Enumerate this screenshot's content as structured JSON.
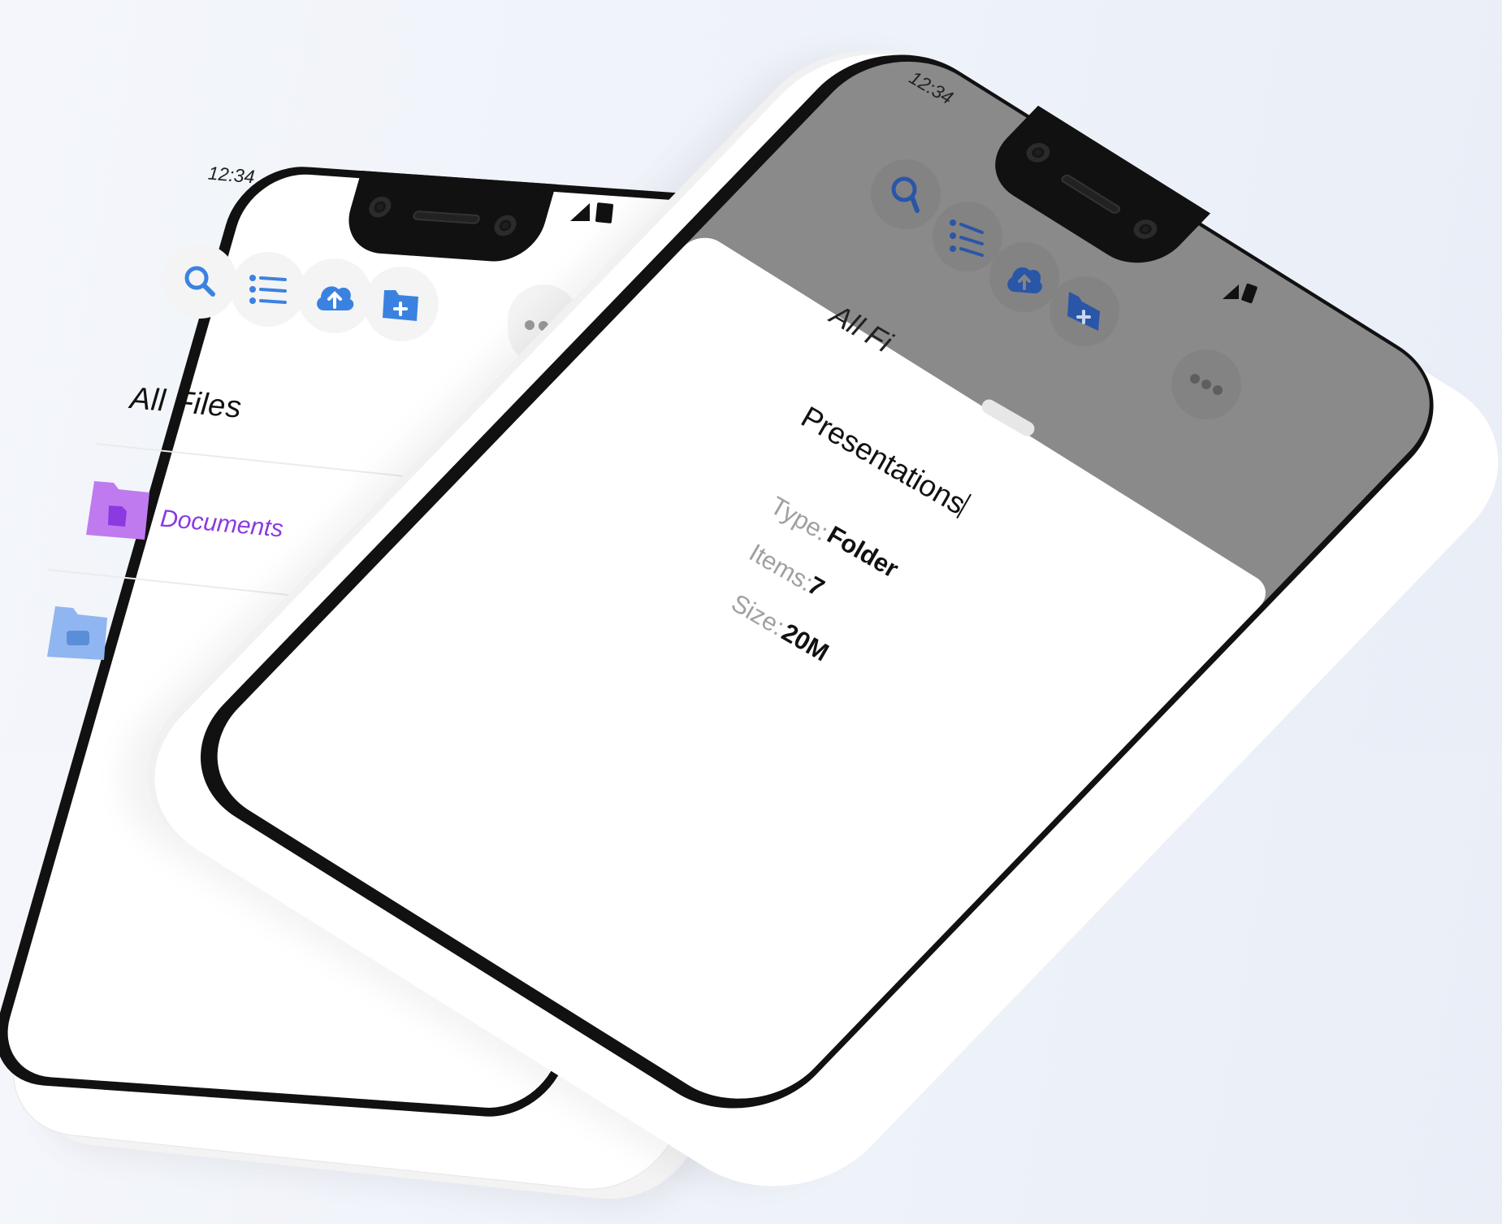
{
  "left_phone": {
    "status": {
      "time": "12:34"
    },
    "toolbar": {
      "search_icon": "search-icon",
      "list_icon": "list-icon",
      "upload_icon": "cloud-upload-icon",
      "new_folder_icon": "folder-plus-icon",
      "more_icon": "more-icon"
    },
    "page_title": "All Files",
    "folders": [
      {
        "name": "Documents",
        "icon": "document-folder-icon",
        "color": "#c07af0"
      },
      {
        "name": "",
        "icon": "camera-folder-icon",
        "color": "#8fb6f0"
      }
    ]
  },
  "right_phone": {
    "status": {
      "time": "12:34"
    },
    "background_title": "All Fi",
    "sheet": {
      "title": "Presentations",
      "type_label": "Type:",
      "type_value": "Folder",
      "items_label": "Items:",
      "items_value": "7",
      "size_label": "Size:",
      "size_value": "20M"
    }
  },
  "colors": {
    "accent": "#3b82e0",
    "purple": "#8a3ae0"
  }
}
